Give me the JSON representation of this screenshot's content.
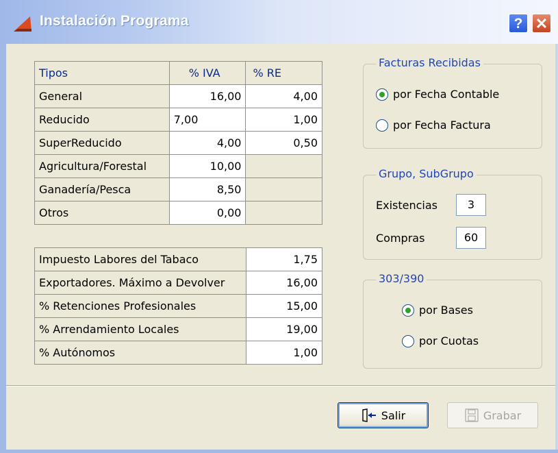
{
  "window": {
    "title": "Instalación Programa",
    "help_label": "?",
    "close_label": "✕"
  },
  "iva_table": {
    "headers": {
      "tipos": "Tipos",
      "iva": "% IVA",
      "re": "% RE"
    },
    "rows": [
      {
        "tipo": "General",
        "iva": "16,00",
        "re": "4,00"
      },
      {
        "tipo": "Reducido",
        "iva": "7,00",
        "re": "1,00"
      },
      {
        "tipo": "SuperReducido",
        "iva": "4,00",
        "re": "0,50"
      },
      {
        "tipo": "Agricultura/Forestal",
        "iva": "10,00",
        "re": ""
      },
      {
        "tipo": "Ganadería/Pesca",
        "iva": "8,50",
        "re": ""
      },
      {
        "tipo": "Otros",
        "iva": "0,00",
        "re": ""
      }
    ]
  },
  "other_table": {
    "rows": [
      {
        "label": "Impuesto Labores del Tabaco",
        "value": "1,75"
      },
      {
        "label": "Exportadores. Máximo a Devolver",
        "value": "16,00"
      },
      {
        "label": "% Retenciones Profesionales",
        "value": "15,00"
      },
      {
        "label": "% Arrendamiento Locales",
        "value": "19,00"
      },
      {
        "label": "% Autónomos",
        "value": "1,00"
      }
    ]
  },
  "facturas": {
    "title": "Facturas Recibidas",
    "options": [
      {
        "label": "por Fecha Contable",
        "selected": true
      },
      {
        "label": "por Fecha Factura",
        "selected": false
      }
    ]
  },
  "grupo": {
    "title": "Grupo, SubGrupo",
    "existencias_label": "Existencias",
    "existencias_value": "3",
    "compras_label": "Compras",
    "compras_value": "60"
  },
  "modelo": {
    "title": "303/390",
    "options": [
      {
        "label": "por Bases",
        "selected": true
      },
      {
        "label": "por Cuotas",
        "selected": false
      }
    ]
  },
  "buttons": {
    "salir": "Salir",
    "grabar": "Grabar"
  },
  "colors": {
    "group_title": "#1f45b8",
    "radio_dot": "#2ba32b",
    "titlebar": "#9fb8e9"
  },
  "icons": {
    "app": "app-icon",
    "salir": "exit-door-icon",
    "grabar": "floppy-disk-icon"
  }
}
